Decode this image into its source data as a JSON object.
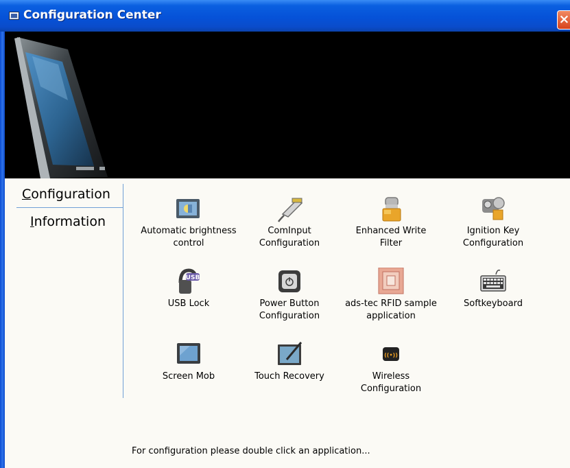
{
  "window": {
    "title": "Configuration Center"
  },
  "nav": {
    "configuration_prefix": "C",
    "configuration_rest": "onfiguration",
    "information_prefix": "I",
    "information_rest": "nformation"
  },
  "apps": [
    {
      "line1": "Automatic brightness",
      "line2": "control",
      "icon": "brightness-icon"
    },
    {
      "line1": "ComInput",
      "line2": "Configuration",
      "icon": "cominput-icon"
    },
    {
      "line1": "Enhanced Write",
      "line2": "Filter",
      "icon": "lock-icon"
    },
    {
      "line1": "Ignition Key",
      "line2": "Configuration",
      "icon": "key-icon"
    },
    {
      "line1": "USB Lock",
      "line2": "",
      "icon": "usb-lock-icon"
    },
    {
      "line1": "Power Button",
      "line2": "Configuration",
      "icon": "power-button-icon"
    },
    {
      "line1": "ads-tec RFID sample",
      "line2": "application",
      "icon": "rfid-icon"
    },
    {
      "line1": "Softkeyboard",
      "line2": "",
      "icon": "keyboard-icon"
    },
    {
      "line1": "Screen Mob",
      "line2": "",
      "icon": "screen-icon"
    },
    {
      "line1": "Touch Recovery",
      "line2": "",
      "icon": "touch-recovery-icon"
    },
    {
      "line1": "Wireless",
      "line2": "Configuration",
      "icon": "wireless-icon"
    }
  ],
  "status": {
    "text": "For configuration please double click an application..."
  },
  "colors": {
    "titlebar": "#0652d8",
    "banner": "#000000",
    "divider": "#6f9fd6",
    "background": "#fbfaf5"
  }
}
